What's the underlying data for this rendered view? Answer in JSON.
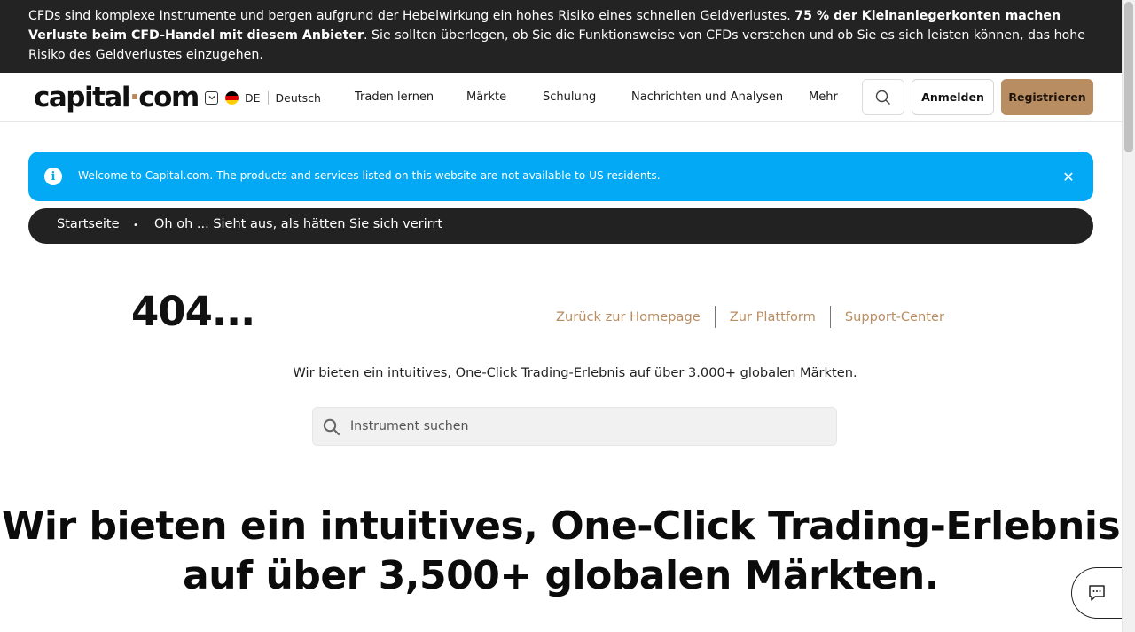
{
  "risk_banner": {
    "text_before": "CFDs sind komplexe Instrumente und bergen aufgrund der Hebelwirkung ein hohes Risiko eines schnellen Geldverlustes. ",
    "text_bold": "75 % der Kleinanlegerkonten machen Verluste beim CFD-Handel mit diesem Anbieter",
    "text_after": ". Sie sollten überlegen, ob Sie die Funktionsweise von CFDs verstehen und ob Sie es sich leisten können, das hohe Risiko des Geldverlustes einzugehen."
  },
  "header": {
    "logo_left": "capital",
    "logo_dot": "·",
    "logo_right": "com",
    "lang_code": "DE",
    "lang_name": "Deutsch",
    "nav": [
      "Traden lernen",
      "Märkte",
      "Schulung",
      "Nachrichten und Analysen",
      "Mehr"
    ],
    "login_label": "Anmelden",
    "register_label": "Registrieren"
  },
  "notice": {
    "text": "Welcome to Capital.com. The products and services listed on this website are not available to US residents.",
    "info_glyph": "i",
    "close_glyph": "✕"
  },
  "breadcrumb": {
    "home": "Startseite",
    "separator": "•",
    "current": "Oh oh ... Sieht aus, als hätten Sie sich verirrt"
  },
  "error": {
    "code": "404...",
    "links": [
      "Zurück zur Homepage",
      "Zur Plattform",
      "Support-Center"
    ],
    "intro": "Wir bieten ein intuitives, One-Click Trading-Erlebnis auf über 3.000+ globalen Märkten.",
    "search_placeholder": "Instrument suchen"
  },
  "headline": {
    "line1": "Wir bieten ein intuitives, One-Click Trading-Erlebnis",
    "line2": "auf über 3,500+ globalen Märkten."
  },
  "colors": {
    "accent": "#b98d62",
    "notice_blue": "#03a9f4",
    "dark": "#232323"
  }
}
